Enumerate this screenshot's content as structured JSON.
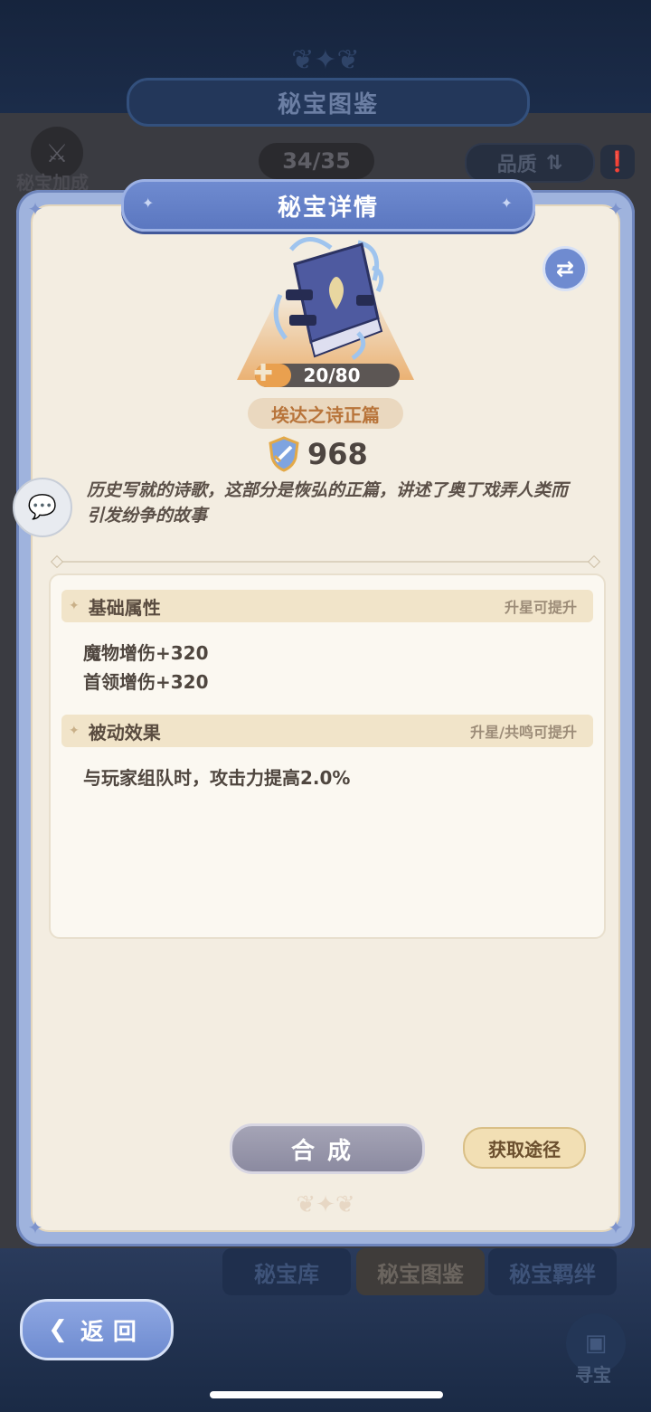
{
  "background": {
    "header_title": "秘宝图鉴",
    "bonus_label": "秘宝加成",
    "collection_count": "34/35",
    "quality_label": "品质",
    "tabs": [
      "秘宝库",
      "秘宝图鉴",
      "秘宝羁绊"
    ],
    "active_tab_index": 1,
    "back_label": "返回",
    "seek_label": "寻宝"
  },
  "modal": {
    "title": "秘宝详情",
    "item": {
      "fragments": "20/80",
      "fragments_progress": 0.25,
      "name": "埃达之诗正篇",
      "power": "968",
      "description": "历史写就的诗歌，这部分是恢弘的正篇，讲述了奥丁戏弄人类而引发纷争的故事"
    },
    "sections": {
      "basic": {
        "title": "基础属性",
        "hint": "升星可提升",
        "lines": [
          "魔物增伤+320",
          "首领增伤+320"
        ]
      },
      "passive": {
        "title": "被动效果",
        "hint": "升星/共鸣可提升",
        "lines": [
          "与玩家组队时，攻击力提高2.0%"
        ]
      }
    },
    "synthesize_label": "合成",
    "acquire_label": "获取途径"
  },
  "colors": {
    "accent_blue": "#6f8bd0",
    "parchment": "#f3ede1",
    "progress_orange": "#e9a04f",
    "item_name": "#b8743a"
  },
  "icons": [
    "crest-icon",
    "bonus-icon",
    "sort-icon",
    "info-icon",
    "swap-icon",
    "book-icon",
    "puzzle-icon",
    "shield-sword-icon",
    "chat-icon",
    "back-arrow-icon",
    "treasure-chest-icon"
  ]
}
